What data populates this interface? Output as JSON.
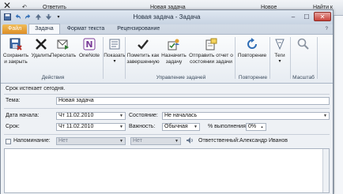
{
  "background_app": {
    "items": [
      "Ответить",
      "Новая задача",
      "Новое",
      "Найти к"
    ]
  },
  "window": {
    "title": "Новая задача  -  Задача",
    "tabs": [
      "Файл",
      "Задача",
      "Формат текста",
      "Рецензирование"
    ],
    "active_tab": "Задача"
  },
  "ribbon": {
    "buttons": {
      "save_close": "Сохранить и закрыть",
      "delete": "Удалить",
      "forward": "Переслать",
      "onenote": "OneNote",
      "show": "Показать",
      "mark_complete": "Пометить как завершенную",
      "assign": "Назначить задачу",
      "send_report": "Отправить отчет о состоянии задачи",
      "recurrence": "Повторение",
      "tags": "Теги",
      "zoom": "Масштаб"
    },
    "groups": {
      "actions": "Действия",
      "manage": "Управление задачей",
      "recurrence": "Повторение",
      "zoom": "Масштаб"
    }
  },
  "form": {
    "notice": "Срок истекает сегодня.",
    "subject_label": "Тема:",
    "subject_value": "Новая задача",
    "start_label": "Дата начала:",
    "start_value": "Чт 11.02.2010",
    "due_label": "Срок:",
    "due_value": "Чт 11.02.2010",
    "status_label": "Состояние:",
    "status_value": "Не началась",
    "priority_label": "Важность:",
    "priority_value": "Обычная",
    "percent_label": "% выполнения:",
    "percent_value": "0%",
    "reminder_label": "Напоминание:",
    "reminder_date": "Нет",
    "reminder_time": "Нет",
    "owner_label": "Ответственный:",
    "owner_value": "Александр Иванов"
  },
  "colors": {
    "file_tab": "#de8e25",
    "ribbon_bg": "#f6f8fb",
    "close_button": "#c9423a"
  }
}
